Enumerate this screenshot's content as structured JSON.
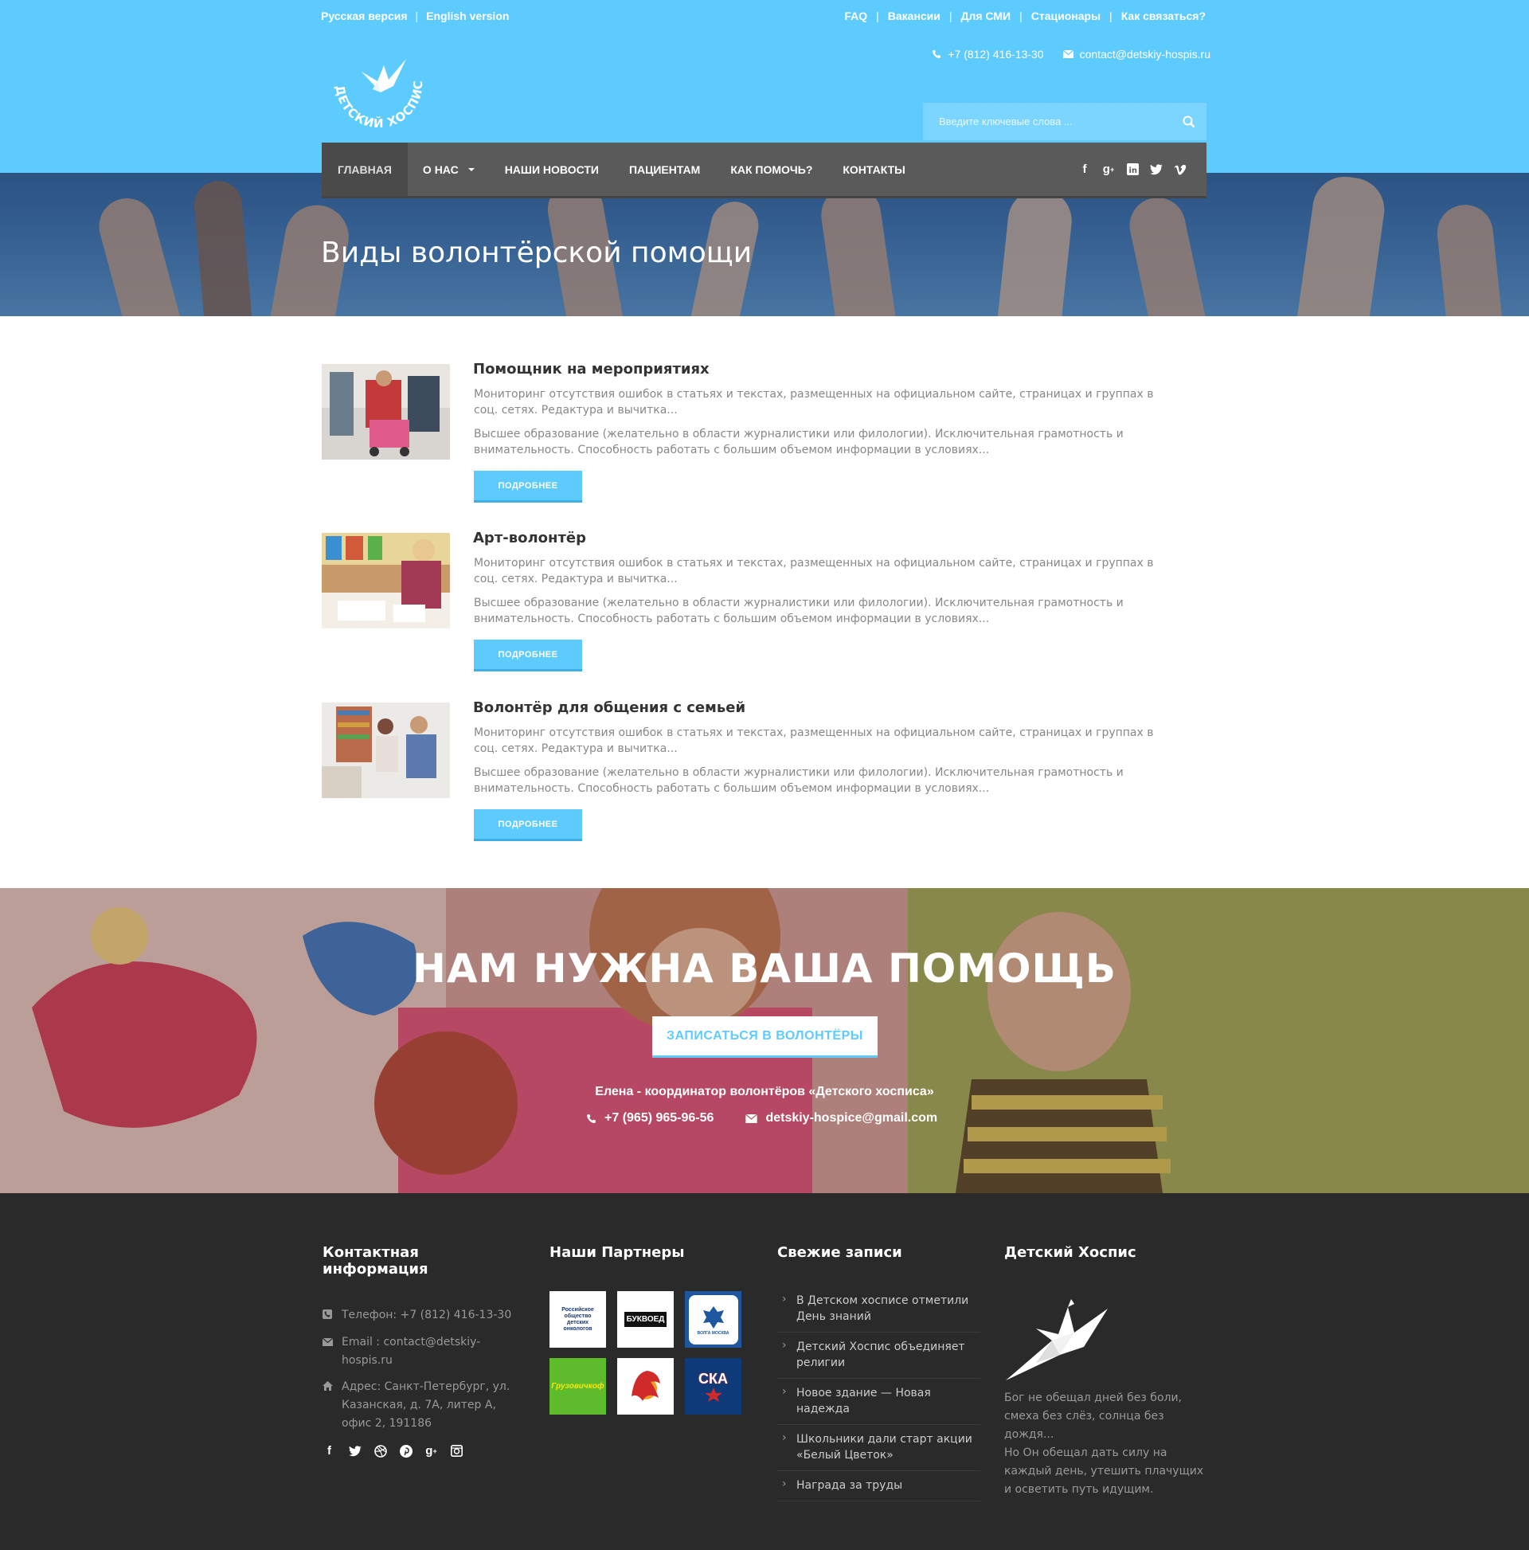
{
  "header": {
    "lang": [
      "Русская версия",
      "English version"
    ],
    "top_links": [
      "FAQ",
      "Вакансии",
      "Для СМИ",
      "Стационары",
      "Как связаться?"
    ],
    "phone": "+7 (812) 416-13-30",
    "email": "contact@detskiy-hospis.ru",
    "logo_text": "ДЕТСКИЙ ХОСПИС",
    "search_placeholder": "Введите ключевые слова ..."
  },
  "nav": {
    "items": [
      "ГЛАВНАЯ",
      "О НАС",
      "НАШИ НОВОСТИ",
      "ПАЦИЕНТАМ",
      "КАК ПОМОЧЬ?",
      "КОНТАКТЫ"
    ],
    "active": "ГЛАВНАЯ",
    "social": [
      "facebook-icon",
      "google-plus-icon",
      "linkedin-icon",
      "twitter-icon",
      "vimeo-icon"
    ]
  },
  "hero": {
    "title": "Виды волонтёрской помощи"
  },
  "articles": [
    {
      "title": "Помощник на мероприятиях",
      "p1": "Мониторинг отсутствия ошибок в статьях и текстах, размещенных на официальном сайте, страницах и группах в соц. сетях. Редактура и вычитка...",
      "p2": "Высшее образование (желательно в области журналистики или филологии). Исключительная грамотность и внимательность. Способность работать с большим объемом информации в условиях...",
      "button": "ПОДРОБНЕЕ"
    },
    {
      "title": "Арт-волонтёр",
      "p1": "Мониторинг отсутствия ошибок в статьях и текстах, размещенных на официальном сайте, страницах и группах в соц. сетях. Редактура и вычитка...",
      "p2": "Высшее образование (желательно в области журналистики или филологии). Исключительная грамотность и внимательность. Способность работать с большим объемом информации в условиях...",
      "button": "ПОДРОБНЕЕ"
    },
    {
      "title": "Волонтёр для общения с семьей",
      "p1": "Мониторинг отсутствия ошибок в статьях и текстах, размещенных на официальном сайте, страницах и группах в соц. сетях. Редактура и вычитка...",
      "p2": "Высшее образование (желательно в области журналистики или филологии). Исключительная грамотность и внимательность. Способность работать с большим объемом информации в условиях...",
      "button": "ПОДРОБНЕЕ"
    }
  ],
  "cta": {
    "title": "НАМ НУЖНА ВАША ПОМОЩЬ",
    "button": "ЗАПИСАТЬСЯ В ВОЛОНТЁРЫ",
    "coordinator": "Елена - координатор волонтёров «Детского хосписа»",
    "phone": "+7 (965) 965-96-56",
    "email": "detskiy-hospice@gmail.com"
  },
  "footer": {
    "contact": {
      "heading": "Контактная информация",
      "phone": "Телефон: +7 (812) 416-13-30",
      "email": "Email : contact@detskiy-hospis.ru",
      "address": "Адрес: Санкт-Петербург, ул. Казанская, д. 7А, литер А, офис 2, 191186",
      "social": [
        "facebook-icon",
        "twitter-icon",
        "dribbble-icon",
        "pinterest-icon",
        "google-plus-icon",
        "instagram-icon"
      ]
    },
    "partners": {
      "heading": "Наши Партнеры",
      "items": [
        {
          "label": "Российское общество детских онкологов",
          "color": "#ffffff",
          "fg": "#1d3a6b"
        },
        {
          "label": "БУКВОЕД",
          "color": "#ffffff",
          "fg": "#111111"
        },
        {
          "label": "ВОЛГА МОСКВА",
          "color": "#1e56a0",
          "fg": "#ffffff"
        },
        {
          "label": "Грузовичкоф",
          "color": "#5dbb2c",
          "fg": "#ffe400"
        },
        {
          "label": "",
          "color": "#ffffff",
          "fg": "#d02a2a"
        },
        {
          "label": "СКА",
          "color": "#0f3a7a",
          "fg": "#ffffff"
        }
      ]
    },
    "posts": {
      "heading": "Свежие записи",
      "items": [
        "В Детском хосписе отметили День знаний",
        "Детский Хоспис объединяет религии",
        "Новое здание — Новая надежда",
        "Школьники дали старт акции «Белый Цветок»",
        "Награда за труды"
      ]
    },
    "about": {
      "heading": "Детский Хоспис",
      "quote": [
        "Бог не обещал дней без боли, смеха без слёз, солнца без дождя...",
        "Но Он обещал дать силу на каждый день, утешить плачущих",
        "и осветить путь идущим."
      ]
    }
  }
}
